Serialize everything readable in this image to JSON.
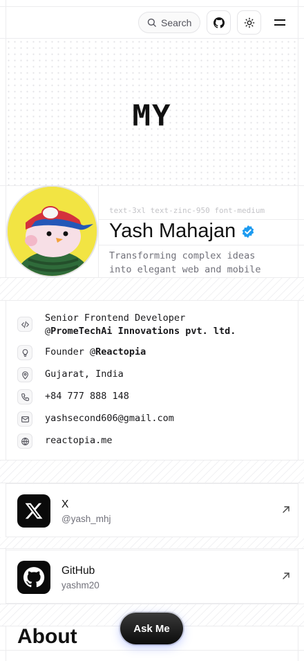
{
  "header": {
    "search_label": "Search",
    "icons": {
      "search": "search-icon",
      "github": "github-icon",
      "theme": "sun-icon",
      "menu": "menu-icon"
    }
  },
  "banner": {
    "text": "MY"
  },
  "profile": {
    "caption": "text-3xl text-zinc-950 font-medium",
    "name": "Yash Mahajan",
    "tagline": "Transforming complex ideas into elegant web and mobile applications.",
    "verified_color": "#1d9bf0"
  },
  "info": [
    {
      "icon": "code-icon",
      "line1": "Senior Frontend Developer",
      "line2_prefix": "@",
      "line2": "PromeTechAi Innovations pvt. ltd."
    },
    {
      "icon": "lightbulb-icon",
      "text_prefix": "Founder @",
      "text": "Reactopia"
    },
    {
      "icon": "map-pin-icon",
      "text": "Gujarat, India"
    },
    {
      "icon": "phone-icon",
      "text": "+84 777 888 148"
    },
    {
      "icon": "mail-icon",
      "text": "yashsecond606@gmail.com"
    },
    {
      "icon": "globe-icon",
      "text": "reactopia.me"
    }
  ],
  "social": [
    {
      "icon": "x-logo-icon",
      "title": "X",
      "handle": "@yash_mhj"
    },
    {
      "icon": "github-logo-icon",
      "title": "GitHub",
      "handle": "yashm20"
    }
  ],
  "about": {
    "heading": "About"
  },
  "ask_me": {
    "label": "Ask Me"
  }
}
